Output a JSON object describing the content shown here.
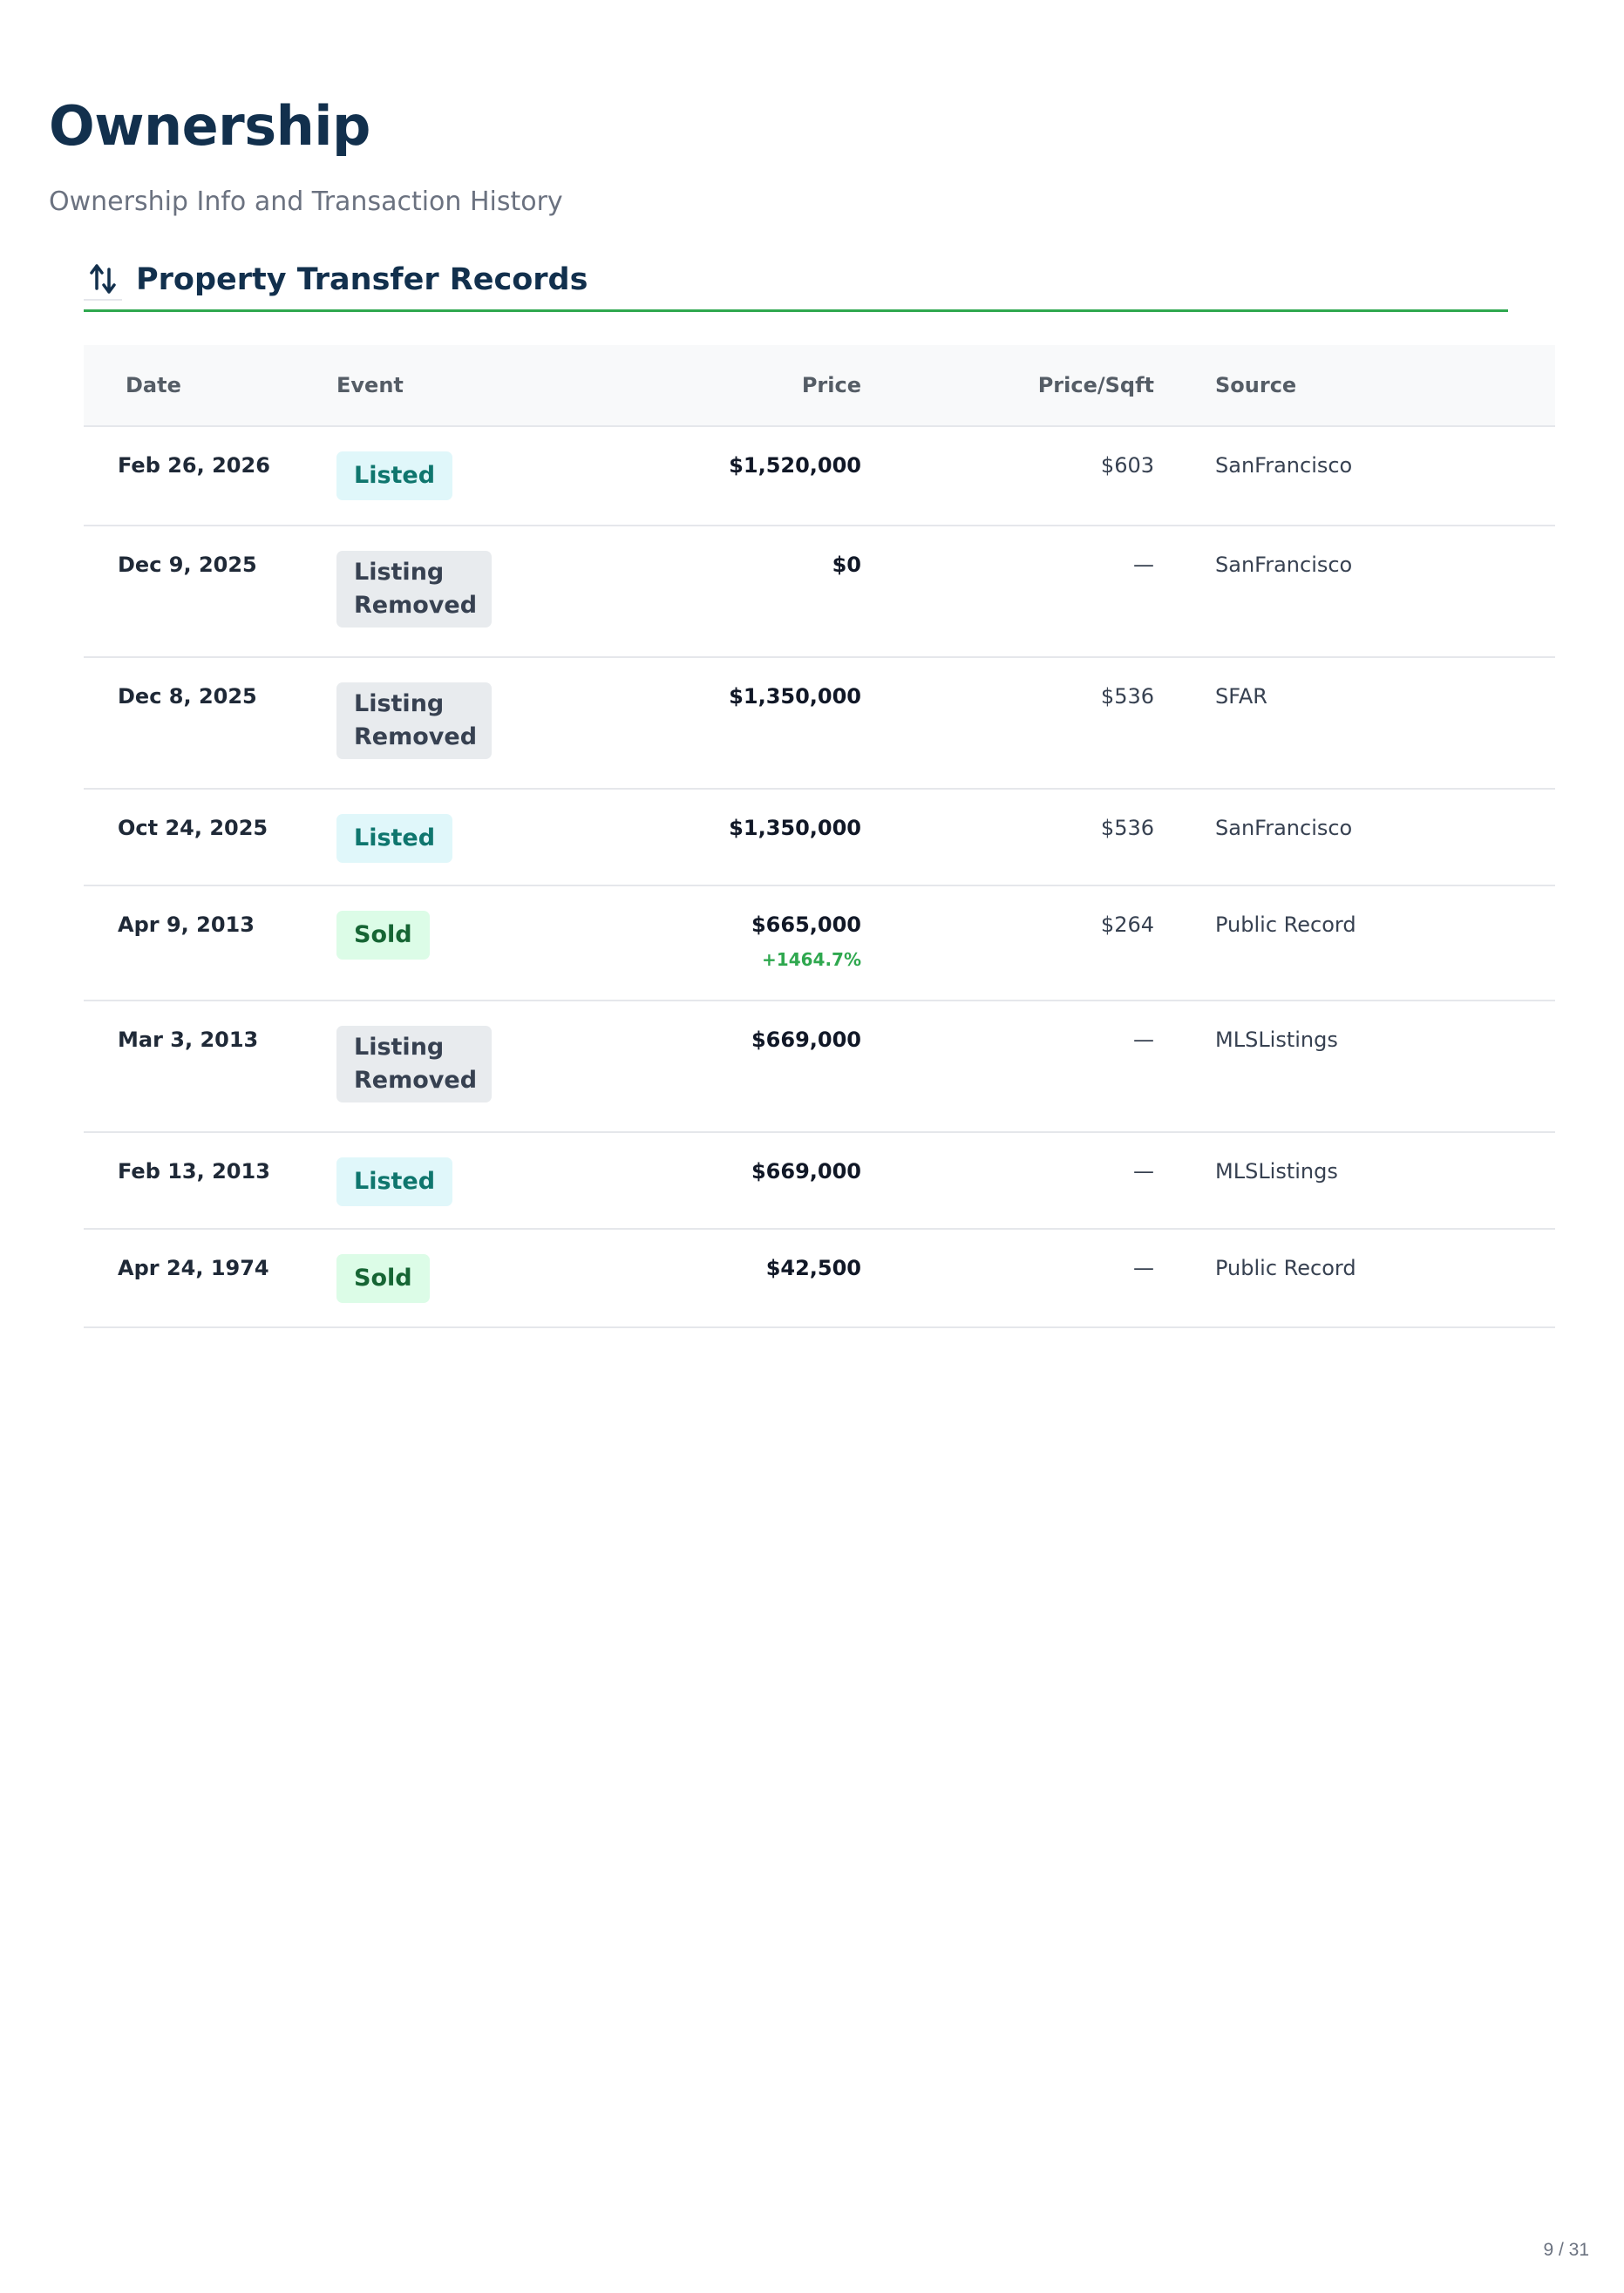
{
  "page": {
    "title": "Ownership",
    "subtitle": "Ownership Info and Transaction History",
    "page_number": "9 / 31"
  },
  "section": {
    "title": "Property Transfer Records",
    "icon": "transfer-arrows-icon",
    "accent_color": "#2fa84f"
  },
  "table": {
    "headers": {
      "date": "Date",
      "event": "Event",
      "price": "Price",
      "price_sqft": "Price/Sqft",
      "source": "Source"
    },
    "rows": [
      {
        "date": "Feb 26, 2026",
        "event": "Listed",
        "price": "$1,520,000",
        "change": "",
        "price_sqft": "$603",
        "source": "SanFrancisco"
      },
      {
        "date": "Dec 9, 2025",
        "event": "Listing Removed",
        "price": "$0",
        "change": "",
        "price_sqft": "—",
        "source": "SanFrancisco"
      },
      {
        "date": "Dec 8, 2025",
        "event": "Listing Removed",
        "price": "$1,350,000",
        "change": "",
        "price_sqft": "$536",
        "source": "SFAR"
      },
      {
        "date": "Oct 24, 2025",
        "event": "Listed",
        "price": "$1,350,000",
        "change": "",
        "price_sqft": "$536",
        "source": "SanFrancisco"
      },
      {
        "date": "Apr 9, 2013",
        "event": "Sold",
        "price": "$665,000",
        "change": "+1464.7%",
        "price_sqft": "$264",
        "source": "Public Record"
      },
      {
        "date": "Mar 3, 2013",
        "event": "Listing Removed",
        "price": "$669,000",
        "change": "",
        "price_sqft": "—",
        "source": "MLSListings"
      },
      {
        "date": "Feb 13, 2013",
        "event": "Listed",
        "price": "$669,000",
        "change": "",
        "price_sqft": "—",
        "source": "MLSListings"
      },
      {
        "date": "Apr 24, 1974",
        "event": "Sold",
        "price": "$42,500",
        "change": "",
        "price_sqft": "—",
        "source": "Public Record"
      }
    ]
  }
}
